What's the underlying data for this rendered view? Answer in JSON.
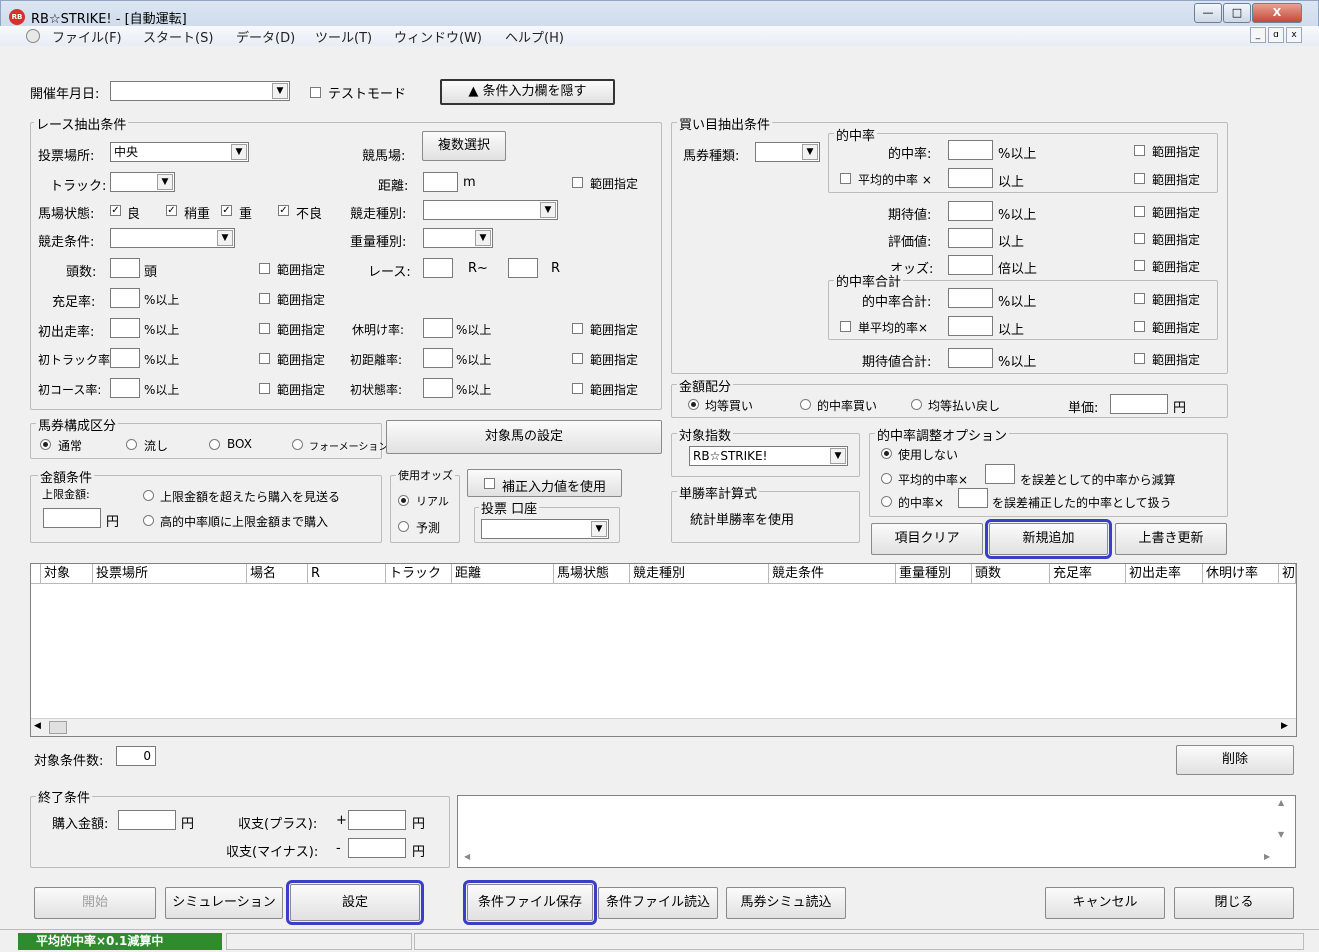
{
  "window": {
    "title": "RB☆STRIKE! - [自動運転]",
    "min": "—",
    "max": "□",
    "close": "X"
  },
  "menu": [
    "ファイル(F)",
    "スタート(S)",
    "データ(D)",
    "ツール(T)",
    "ウィンドウ(W)",
    "ヘルプ(H)"
  ],
  "mdi": {
    "min": "_",
    "restore": "ɑ",
    "close": "x"
  },
  "topbar": {
    "date_label": "開催年月日:",
    "test_mode": "テストモード",
    "hide_btn": "▲ 条件入力欄を隠す"
  },
  "race": {
    "group": "レース抽出条件",
    "venue_label": "投票場所:",
    "venue_value": "中央",
    "course_label": "競馬場:",
    "multi_btn": "複数選択",
    "track_label": "トラック:",
    "dist_label": "距離:",
    "dist_unit": "m",
    "range": "範囲指定",
    "ground_label": "馬場状態:",
    "ground": [
      "良",
      "稍重",
      "重",
      "不良"
    ],
    "race_type_label": "競走種別:",
    "cond_label": "競走条件:",
    "weight_label": "重量種別:",
    "heads_label": "頭数:",
    "heads_unit": "頭",
    "race_label": "レース:",
    "race_r1": "R~",
    "race_r2": "R",
    "fill_label": "充足率:",
    "pct_unit": "%以上",
    "first_run_label": "初出走率:",
    "rest_label": "休明け率:",
    "first_track_label": "初トラック率:",
    "first_dist_label": "初距離率:",
    "first_course_label": "初コース率:",
    "first_ground_label": "初状態率:"
  },
  "bet": {
    "group": "馬券構成区分",
    "opts": [
      "通常",
      "流し",
      "BOX",
      "フォーメーション"
    ],
    "target_btn": "対象馬の設定"
  },
  "amount": {
    "group": "金額条件",
    "limit_label": "上限金額:",
    "unit": "円",
    "opt1": "上限金額を超えたら購入を見送る",
    "opt2": "高的中率順に上限金額まで購入"
  },
  "odds": {
    "group": "使用オッズ",
    "real": "リアル",
    "forecast": "予測",
    "corr": "補正入力値を使用",
    "acct_group": "投票 口座"
  },
  "buy": {
    "group": "買い目抽出条件",
    "ticket_label": "馬券種類:"
  },
  "hit": {
    "group": "的中率",
    "hit_label": "的中率:",
    "pct": "%以上",
    "avg_label": "平均的中率 ×",
    "over": "以上",
    "exp_label": "期待値:",
    "eval_label": "評価値:",
    "odds_label": "オッズ:",
    "odds_unit": "倍以上",
    "range": "範囲指定"
  },
  "hitsum": {
    "group": "的中率合計",
    "sum_label": "的中率合計:",
    "single_label": "単平均的率×",
    "exp_sum_label": "期待値合計:"
  },
  "alloc": {
    "group": "金額配分",
    "opts": [
      "均等買い",
      "的中率買い",
      "均等払い戻し"
    ],
    "unit_label": "単価:",
    "yen": "円"
  },
  "index": {
    "group": "対象指数",
    "value": "RB☆STRIKE!"
  },
  "adj": {
    "group": "的中率調整オプション",
    "opt0": "使用しない",
    "opt1a": "平均的中率×",
    "opt1b": "を誤差として的中率から減算",
    "opt2a": "的中率×",
    "opt2b": "を誤差補正した的中率として扱う"
  },
  "winrate": {
    "group": "単勝率計算式",
    "text": "統計単勝率を使用"
  },
  "actions": {
    "clear": "項目クリア",
    "add": "新規追加",
    "overwrite": "上書き更新"
  },
  "grid": {
    "headers": [
      "対象",
      "投票場所",
      "場名",
      "R",
      "トラック",
      "距離",
      "馬場状態",
      "競走種別",
      "競走条件",
      "重量種別",
      "頭数",
      "充足率",
      "初出走率",
      "休明け率",
      "初"
    ]
  },
  "count": {
    "label": "対象条件数:",
    "value": "0",
    "delete": "削除"
  },
  "end": {
    "group": "終了条件",
    "purchase_label": "購入金額:",
    "yen": "円",
    "plus_label": "収支(プラス):",
    "plus_sign": "+",
    "minus_label": "収支(マイナス):",
    "minus_sign": "-"
  },
  "bottom": {
    "start": "開始",
    "sim": "シミュレーション",
    "settings": "設定",
    "save": "条件ファイル保存",
    "load": "条件ファイル読込",
    "sim_load": "馬券シミュ読込",
    "cancel": "キャンセル",
    "close": "閉じる"
  },
  "status": {
    "text": "平均的中率×0.1減算中"
  }
}
